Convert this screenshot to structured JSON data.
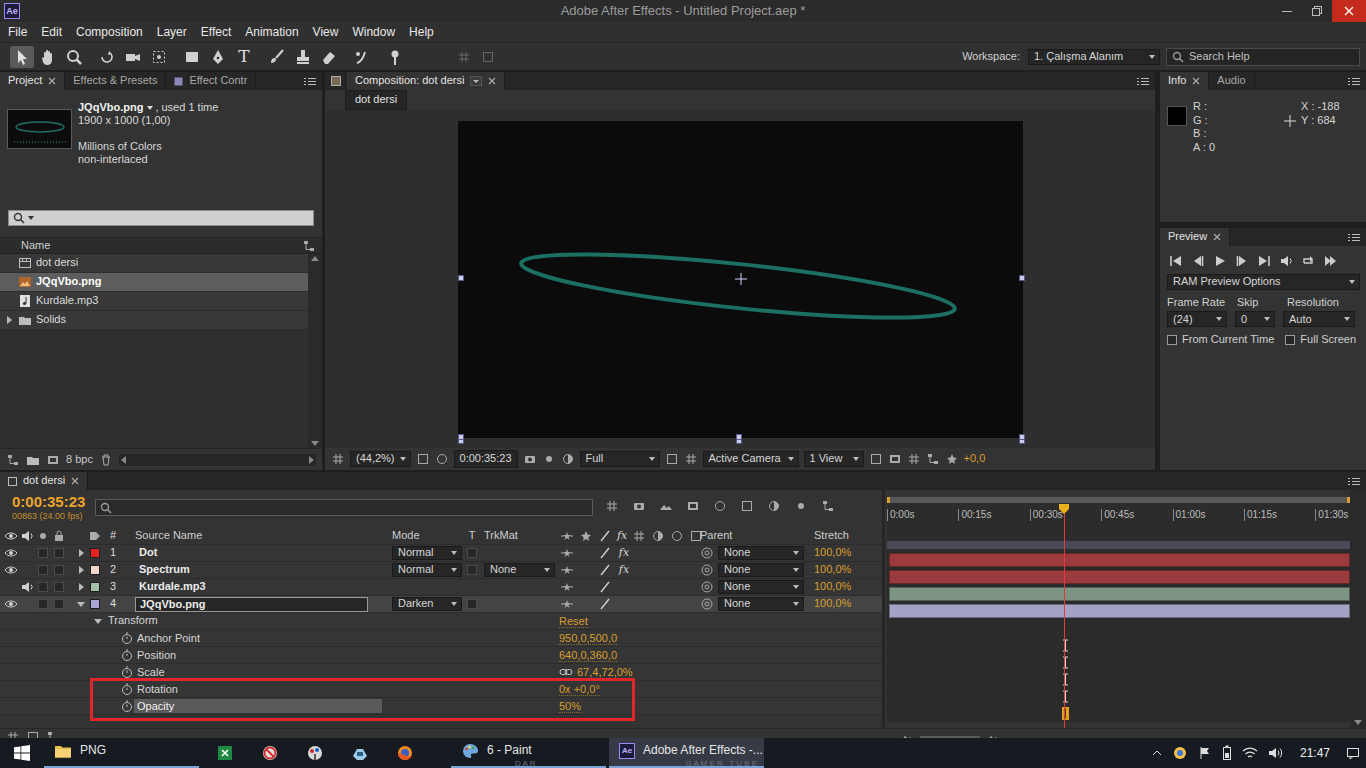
{
  "window": {
    "app_icon": "Ae",
    "title": "Adobe After Effects - Untitled Project.aep *"
  },
  "menu": [
    "File",
    "Edit",
    "Composition",
    "Layer",
    "Effect",
    "Animation",
    "View",
    "Window",
    "Help"
  ],
  "toolbar": {
    "tools": [
      {
        "selected": true
      },
      {
        "selected": false
      },
      {
        "selected": false
      },
      {
        "selected": false
      },
      {
        "selected": false
      },
      {
        "selected": false
      },
      {
        "selected": false
      },
      {
        "selected": false
      },
      {
        "selected": false,
        "label": "T"
      },
      {
        "selected": false
      },
      {
        "selected": false
      },
      {
        "selected": false
      },
      {
        "selected": false
      },
      {
        "selected": false
      }
    ],
    "workspace_label": "Workspace:",
    "workspace": "1. Çalışma Alanım",
    "search_placeholder": "Search Help"
  },
  "project": {
    "tabs": [
      {
        "label": "Project",
        "selected": true
      },
      {
        "label": "Effects & Presets",
        "selected": false
      },
      {
        "label": "Effect Contr",
        "selected": false
      }
    ],
    "preview": {
      "name": "JQqVbo.png",
      "usage": ", used 1 time",
      "dimensions": "1900 x 1000 (1,00)",
      "colors": "Millions of Colors",
      "field": "non-interlaced"
    },
    "name_column": "Name",
    "items": [
      {
        "name": "dot dersi",
        "kind": "composition",
        "selected": false
      },
      {
        "name": "JQqVbo.png",
        "kind": "image",
        "selected": true
      },
      {
        "name": "Kurdale.mp3",
        "kind": "audio",
        "selected": false
      },
      {
        "name": "Solids",
        "kind": "folder",
        "selected": false,
        "expanded": false
      }
    ],
    "bit_depth": "8 bpc"
  },
  "composition": {
    "tab": "Composition: dot dersi",
    "breadcrumb": "dot dersi",
    "zoom": "(44,2%)",
    "time": "0:00:35:23",
    "resolution": "Full",
    "camera": "Active Camera",
    "views": "1 View",
    "exposure": "+0,0"
  },
  "info": {
    "tabs": [
      {
        "label": "Info",
        "selected": true
      },
      {
        "label": "Audio",
        "selected": false
      }
    ],
    "channels": [
      "R :",
      "G :",
      "B :",
      "A : 0"
    ],
    "swatch_color": "#000000",
    "coords": [
      "X : -188",
      "Y : 684"
    ]
  },
  "preview": {
    "tab": "Preview",
    "options": "RAM Preview Options",
    "frame_rate": {
      "label": "Frame Rate",
      "value": "(24)"
    },
    "skip": {
      "label": "Skip",
      "value": "0"
    },
    "resolution": {
      "label": "Resolution",
      "value": "Auto"
    },
    "checkboxes": [
      {
        "label": "From Current Time",
        "checked": false
      },
      {
        "label": "Full Screen",
        "checked": false
      }
    ]
  },
  "timeline": {
    "tab": "dot dersi",
    "time": "0:00:35:23",
    "frame": "00863 (24.00 fps)",
    "ruler": [
      "0:00s",
      "00:15s",
      "00:30s",
      "00:45s",
      "01:00s",
      "01:15s",
      "01:30s"
    ],
    "playhead": 0.385,
    "columns": {
      "number": "#",
      "source": "Source Name",
      "mode": "Mode",
      "t": "T",
      "trkmat": "TrkMat",
      "switch_fx": "fx",
      "parent": "Parent",
      "stretch": "Stretch"
    },
    "layers": [
      {
        "number": "1",
        "name": "Dot",
        "color": "#e52323",
        "bar_color": "#9c3b3e",
        "video": true,
        "audio": false,
        "expanded": false,
        "selected": false,
        "mode": "Normal",
        "trkmat": null,
        "effect_switch": "fx",
        "parent": "None",
        "stretch": "100,0%"
      },
      {
        "number": "2",
        "name": "Spectrum",
        "color": "#f2d4c9",
        "bar_color": "#9c3b3e",
        "video": true,
        "audio": false,
        "expanded": false,
        "selected": false,
        "mode": "Normal",
        "trkmat": "None",
        "effect_switch": "fx",
        "parent": "None",
        "stretch": "100,0%"
      },
      {
        "number": "3",
        "name": "Kurdale.mp3",
        "color": "#a6c0a5",
        "bar_color": "#7d9383",
        "video": false,
        "audio": true,
        "expanded": false,
        "selected": false,
        "mode": null,
        "trkmat": null,
        "effect_switch": null,
        "parent": "None",
        "stretch": "100,0%"
      },
      {
        "number": "4",
        "name": "JQqVbo.png",
        "color": "#aaa6d6",
        "bar_color": "#a4a3c6",
        "video": true,
        "audio": false,
        "expanded": true,
        "selected": true,
        "mode": "Darken",
        "trkmat": null,
        "effect_switch": null,
        "parent": "None",
        "stretch": "100,0%"
      }
    ],
    "transform": {
      "label": "Transform",
      "reset": "Reset",
      "expanded": true,
      "properties": [
        {
          "name": "Anchor Point",
          "value": "950,0,500,0",
          "linked": false,
          "keyframed": false,
          "selected": false,
          "highlighted": false
        },
        {
          "name": "Position",
          "value": "640,0,360,0",
          "linked": false,
          "keyframed": false,
          "selected": false,
          "highlighted": false
        },
        {
          "name": "Scale",
          "value": "67,4,72,0%",
          "linked": true,
          "keyframed": false,
          "selected": false,
          "highlighted": false
        },
        {
          "name": "Rotation",
          "value": "0x +0,0°",
          "linked": false,
          "keyframed": false,
          "selected": false,
          "highlighted": true
        },
        {
          "name": "Opacity",
          "value": "50%",
          "linked": false,
          "keyframed": true,
          "selected": true,
          "highlighted": true
        }
      ]
    }
  },
  "taskbar": {
    "buttons": [
      {
        "label": "PNG",
        "selected": false
      },
      {
        "label": "6 - Paint",
        "selected": false
      },
      {
        "label": "Adobe After Effects -...",
        "selected": true
      }
    ],
    "clock": "21:47",
    "watermark": [
      "D A R",
      "G A M E R   T U B E"
    ]
  }
}
